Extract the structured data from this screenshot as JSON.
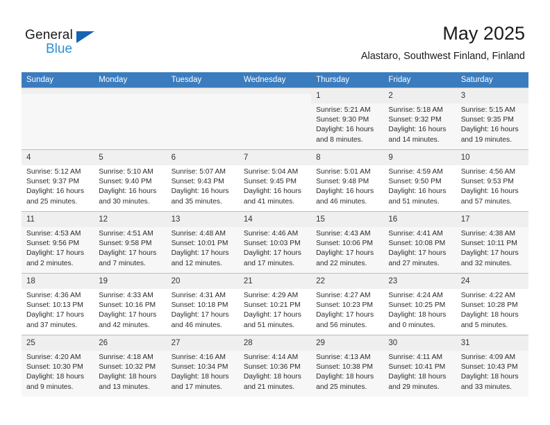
{
  "brand": {
    "name_part1": "General",
    "name_part2": "Blue",
    "triangle_color": "#1565b0",
    "blue_color": "#2d8fd5"
  },
  "header": {
    "month_title": "May 2025",
    "location": "Alastaro, Southwest Finland, Finland"
  },
  "theme": {
    "header_row_bg": "#3b7cbe",
    "header_row_text": "#ffffff",
    "daynum_bg": "#f0f0f0",
    "row_shade_bg": "#f7f7f7",
    "grid_line": "#bdbdbd"
  },
  "weekdays": [
    "Sunday",
    "Monday",
    "Tuesday",
    "Wednesday",
    "Thursday",
    "Friday",
    "Saturday"
  ],
  "labels": {
    "sunrise_prefix": "Sunrise:",
    "sunset_prefix": "Sunset:",
    "daylight_prefix": "Daylight:"
  },
  "weeks": [
    [
      {
        "day": "",
        "lines": []
      },
      {
        "day": "",
        "lines": []
      },
      {
        "day": "",
        "lines": []
      },
      {
        "day": "",
        "lines": []
      },
      {
        "day": "1",
        "lines": [
          "Sunrise: 5:21 AM",
          "Sunset: 9:30 PM",
          "Daylight: 16 hours",
          "and 8 minutes."
        ]
      },
      {
        "day": "2",
        "lines": [
          "Sunrise: 5:18 AM",
          "Sunset: 9:32 PM",
          "Daylight: 16 hours",
          "and 14 minutes."
        ]
      },
      {
        "day": "3",
        "lines": [
          "Sunrise: 5:15 AM",
          "Sunset: 9:35 PM",
          "Daylight: 16 hours",
          "and 19 minutes."
        ]
      }
    ],
    [
      {
        "day": "4",
        "lines": [
          "Sunrise: 5:12 AM",
          "Sunset: 9:37 PM",
          "Daylight: 16 hours",
          "and 25 minutes."
        ]
      },
      {
        "day": "5",
        "lines": [
          "Sunrise: 5:10 AM",
          "Sunset: 9:40 PM",
          "Daylight: 16 hours",
          "and 30 minutes."
        ]
      },
      {
        "day": "6",
        "lines": [
          "Sunrise: 5:07 AM",
          "Sunset: 9:43 PM",
          "Daylight: 16 hours",
          "and 35 minutes."
        ]
      },
      {
        "day": "7",
        "lines": [
          "Sunrise: 5:04 AM",
          "Sunset: 9:45 PM",
          "Daylight: 16 hours",
          "and 41 minutes."
        ]
      },
      {
        "day": "8",
        "lines": [
          "Sunrise: 5:01 AM",
          "Sunset: 9:48 PM",
          "Daylight: 16 hours",
          "and 46 minutes."
        ]
      },
      {
        "day": "9",
        "lines": [
          "Sunrise: 4:59 AM",
          "Sunset: 9:50 PM",
          "Daylight: 16 hours",
          "and 51 minutes."
        ]
      },
      {
        "day": "10",
        "lines": [
          "Sunrise: 4:56 AM",
          "Sunset: 9:53 PM",
          "Daylight: 16 hours",
          "and 57 minutes."
        ]
      }
    ],
    [
      {
        "day": "11",
        "lines": [
          "Sunrise: 4:53 AM",
          "Sunset: 9:56 PM",
          "Daylight: 17 hours",
          "and 2 minutes."
        ]
      },
      {
        "day": "12",
        "lines": [
          "Sunrise: 4:51 AM",
          "Sunset: 9:58 PM",
          "Daylight: 17 hours",
          "and 7 minutes."
        ]
      },
      {
        "day": "13",
        "lines": [
          "Sunrise: 4:48 AM",
          "Sunset: 10:01 PM",
          "Daylight: 17 hours",
          "and 12 minutes."
        ]
      },
      {
        "day": "14",
        "lines": [
          "Sunrise: 4:46 AM",
          "Sunset: 10:03 PM",
          "Daylight: 17 hours",
          "and 17 minutes."
        ]
      },
      {
        "day": "15",
        "lines": [
          "Sunrise: 4:43 AM",
          "Sunset: 10:06 PM",
          "Daylight: 17 hours",
          "and 22 minutes."
        ]
      },
      {
        "day": "16",
        "lines": [
          "Sunrise: 4:41 AM",
          "Sunset: 10:08 PM",
          "Daylight: 17 hours",
          "and 27 minutes."
        ]
      },
      {
        "day": "17",
        "lines": [
          "Sunrise: 4:38 AM",
          "Sunset: 10:11 PM",
          "Daylight: 17 hours",
          "and 32 minutes."
        ]
      }
    ],
    [
      {
        "day": "18",
        "lines": [
          "Sunrise: 4:36 AM",
          "Sunset: 10:13 PM",
          "Daylight: 17 hours",
          "and 37 minutes."
        ]
      },
      {
        "day": "19",
        "lines": [
          "Sunrise: 4:33 AM",
          "Sunset: 10:16 PM",
          "Daylight: 17 hours",
          "and 42 minutes."
        ]
      },
      {
        "day": "20",
        "lines": [
          "Sunrise: 4:31 AM",
          "Sunset: 10:18 PM",
          "Daylight: 17 hours",
          "and 46 minutes."
        ]
      },
      {
        "day": "21",
        "lines": [
          "Sunrise: 4:29 AM",
          "Sunset: 10:21 PM",
          "Daylight: 17 hours",
          "and 51 minutes."
        ]
      },
      {
        "day": "22",
        "lines": [
          "Sunrise: 4:27 AM",
          "Sunset: 10:23 PM",
          "Daylight: 17 hours",
          "and 56 minutes."
        ]
      },
      {
        "day": "23",
        "lines": [
          "Sunrise: 4:24 AM",
          "Sunset: 10:25 PM",
          "Daylight: 18 hours",
          "and 0 minutes."
        ]
      },
      {
        "day": "24",
        "lines": [
          "Sunrise: 4:22 AM",
          "Sunset: 10:28 PM",
          "Daylight: 18 hours",
          "and 5 minutes."
        ]
      }
    ],
    [
      {
        "day": "25",
        "lines": [
          "Sunrise: 4:20 AM",
          "Sunset: 10:30 PM",
          "Daylight: 18 hours",
          "and 9 minutes."
        ]
      },
      {
        "day": "26",
        "lines": [
          "Sunrise: 4:18 AM",
          "Sunset: 10:32 PM",
          "Daylight: 18 hours",
          "and 13 minutes."
        ]
      },
      {
        "day": "27",
        "lines": [
          "Sunrise: 4:16 AM",
          "Sunset: 10:34 PM",
          "Daylight: 18 hours",
          "and 17 minutes."
        ]
      },
      {
        "day": "28",
        "lines": [
          "Sunrise: 4:14 AM",
          "Sunset: 10:36 PM",
          "Daylight: 18 hours",
          "and 21 minutes."
        ]
      },
      {
        "day": "29",
        "lines": [
          "Sunrise: 4:13 AM",
          "Sunset: 10:38 PM",
          "Daylight: 18 hours",
          "and 25 minutes."
        ]
      },
      {
        "day": "30",
        "lines": [
          "Sunrise: 4:11 AM",
          "Sunset: 10:41 PM",
          "Daylight: 18 hours",
          "and 29 minutes."
        ]
      },
      {
        "day": "31",
        "lines": [
          "Sunrise: 4:09 AM",
          "Sunset: 10:43 PM",
          "Daylight: 18 hours",
          "and 33 minutes."
        ]
      }
    ]
  ]
}
